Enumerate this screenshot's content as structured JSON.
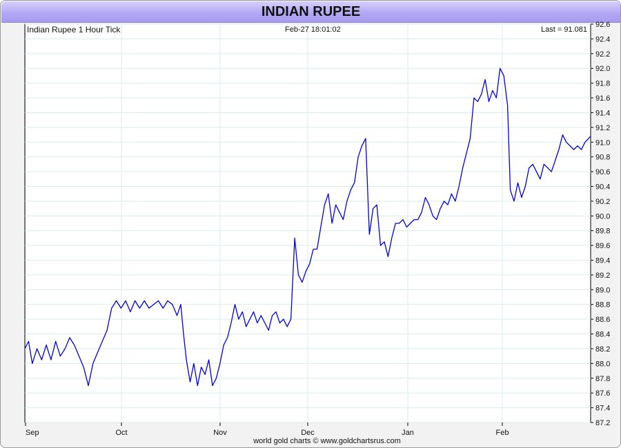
{
  "window": {
    "title": "INDIAN RUPEE"
  },
  "chart_data": {
    "type": "line",
    "title": "Indian Rupee 1 Hour Tick",
    "timestamp": "Feb-27  18:01:02",
    "last_label": "Last = 91.081",
    "footer": "world gold charts © www.goldchartsrus.com",
    "x_axis": {
      "labels": [
        "Sep",
        "Oct",
        "Nov",
        "Dec",
        "Jan",
        "Feb"
      ],
      "range": [
        "Sep",
        "end of Feb"
      ]
    },
    "y_axis": {
      "ylim": [
        87.2,
        92.6
      ],
      "ticks": [
        "87.2",
        "87.4",
        "87.6",
        "87.8",
        "88.0",
        "88.2",
        "88.4",
        "88.6",
        "88.8",
        "89.0",
        "89.2",
        "89.4",
        "89.6",
        "89.8",
        "90.0",
        "90.2",
        "90.4",
        "90.6",
        "90.8",
        "91.0",
        "91.2",
        "91.4",
        "91.6",
        "91.8",
        "92.0",
        "92.2",
        "92.4",
        "92.6"
      ],
      "position": "right"
    },
    "grid": true,
    "series": [
      {
        "color": "#0000dd",
        "points": [
          [
            0.0,
            88.2
          ],
          [
            0.4,
            88.3
          ],
          [
            0.8,
            88.0
          ],
          [
            1.3,
            88.2
          ],
          [
            1.8,
            88.05
          ],
          [
            2.3,
            88.25
          ],
          [
            2.8,
            88.05
          ],
          [
            3.3,
            88.3
          ],
          [
            3.8,
            88.1
          ],
          [
            4.3,
            88.2
          ],
          [
            4.8,
            88.35
          ],
          [
            5.3,
            88.25
          ],
          [
            5.8,
            88.1
          ],
          [
            6.3,
            87.95
          ],
          [
            6.8,
            87.7
          ],
          [
            7.3,
            88.0
          ],
          [
            7.8,
            88.15
          ],
          [
            8.3,
            88.3
          ],
          [
            8.8,
            88.45
          ],
          [
            9.3,
            88.75
          ],
          [
            9.8,
            88.85
          ],
          [
            10.3,
            88.75
          ],
          [
            10.8,
            88.85
          ],
          [
            11.3,
            88.7
          ],
          [
            11.8,
            88.85
          ],
          [
            12.3,
            88.75
          ],
          [
            12.8,
            88.85
          ],
          [
            13.3,
            88.75
          ],
          [
            13.8,
            88.8
          ],
          [
            14.3,
            88.85
          ],
          [
            14.8,
            88.75
          ],
          [
            15.3,
            88.85
          ],
          [
            15.8,
            88.8
          ],
          [
            16.3,
            88.65
          ],
          [
            16.7,
            88.8
          ],
          [
            17.0,
            88.4
          ],
          [
            17.3,
            88.05
          ],
          [
            17.7,
            87.75
          ],
          [
            18.1,
            88.0
          ],
          [
            18.5,
            87.7
          ],
          [
            18.9,
            87.95
          ],
          [
            19.3,
            87.85
          ],
          [
            19.7,
            88.05
          ],
          [
            20.1,
            87.7
          ],
          [
            20.5,
            87.8
          ],
          [
            20.9,
            88.0
          ],
          [
            21.3,
            88.25
          ],
          [
            21.7,
            88.35
          ],
          [
            22.1,
            88.55
          ],
          [
            22.5,
            88.8
          ],
          [
            22.9,
            88.6
          ],
          [
            23.3,
            88.7
          ],
          [
            23.7,
            88.5
          ],
          [
            24.1,
            88.6
          ],
          [
            24.5,
            88.7
          ],
          [
            24.9,
            88.55
          ],
          [
            25.3,
            88.65
          ],
          [
            25.7,
            88.55
          ],
          [
            26.1,
            88.45
          ],
          [
            26.5,
            88.65
          ],
          [
            26.9,
            88.7
          ],
          [
            27.3,
            88.55
          ],
          [
            27.7,
            88.6
          ],
          [
            28.1,
            88.5
          ],
          [
            28.5,
            88.6
          ],
          [
            28.9,
            89.7
          ],
          [
            29.3,
            89.2
          ],
          [
            29.7,
            89.1
          ],
          [
            30.1,
            89.25
          ],
          [
            30.5,
            89.35
          ],
          [
            30.9,
            89.55
          ],
          [
            31.3,
            89.55
          ],
          [
            31.7,
            89.85
          ],
          [
            32.1,
            90.15
          ],
          [
            32.5,
            90.3
          ],
          [
            32.9,
            89.9
          ],
          [
            33.3,
            90.15
          ],
          [
            33.7,
            90.05
          ],
          [
            34.1,
            89.95
          ],
          [
            34.5,
            90.2
          ],
          [
            34.9,
            90.35
          ],
          [
            35.3,
            90.45
          ],
          [
            35.7,
            90.8
          ],
          [
            36.1,
            90.95
          ],
          [
            36.5,
            91.05
          ],
          [
            36.9,
            89.75
          ],
          [
            37.3,
            90.1
          ],
          [
            37.7,
            90.15
          ],
          [
            38.1,
            89.6
          ],
          [
            38.5,
            89.65
          ],
          [
            38.9,
            89.45
          ],
          [
            39.3,
            89.7
          ],
          [
            39.7,
            89.9
          ],
          [
            40.1,
            89.9
          ],
          [
            40.5,
            89.95
          ],
          [
            40.9,
            89.85
          ],
          [
            41.3,
            89.9
          ],
          [
            41.7,
            89.95
          ],
          [
            42.1,
            89.95
          ],
          [
            42.5,
            90.05
          ],
          [
            42.9,
            90.25
          ],
          [
            43.3,
            90.15
          ],
          [
            43.7,
            90.0
          ],
          [
            44.1,
            89.95
          ],
          [
            44.5,
            90.1
          ],
          [
            44.9,
            90.2
          ],
          [
            45.3,
            90.15
          ],
          [
            45.7,
            90.3
          ],
          [
            46.1,
            90.2
          ],
          [
            46.5,
            90.4
          ],
          [
            46.9,
            90.65
          ],
          [
            47.3,
            90.85
          ],
          [
            47.7,
            91.05
          ],
          [
            48.1,
            91.6
          ],
          [
            48.5,
            91.55
          ],
          [
            48.9,
            91.65
          ],
          [
            49.3,
            91.85
          ],
          [
            49.7,
            91.55
          ],
          [
            50.1,
            91.7
          ],
          [
            50.5,
            91.6
          ],
          [
            50.9,
            92.0
          ],
          [
            51.3,
            91.9
          ],
          [
            51.7,
            91.5
          ],
          [
            52.0,
            90.35
          ],
          [
            52.4,
            90.2
          ],
          [
            52.8,
            90.45
          ],
          [
            53.2,
            90.25
          ],
          [
            53.6,
            90.4
          ],
          [
            54.0,
            90.65
          ],
          [
            54.4,
            90.7
          ],
          [
            54.8,
            90.6
          ],
          [
            55.2,
            90.5
          ],
          [
            55.6,
            90.7
          ],
          [
            56.0,
            90.65
          ],
          [
            56.4,
            90.6
          ],
          [
            56.8,
            90.75
          ],
          [
            57.2,
            90.9
          ],
          [
            57.6,
            91.1
          ],
          [
            58.0,
            91.0
          ],
          [
            58.4,
            90.95
          ],
          [
            58.8,
            90.9
          ],
          [
            59.2,
            90.95
          ],
          [
            59.6,
            90.9
          ],
          [
            60.0,
            91.0
          ],
          [
            60.6,
            91.08
          ]
        ]
      }
    ]
  }
}
